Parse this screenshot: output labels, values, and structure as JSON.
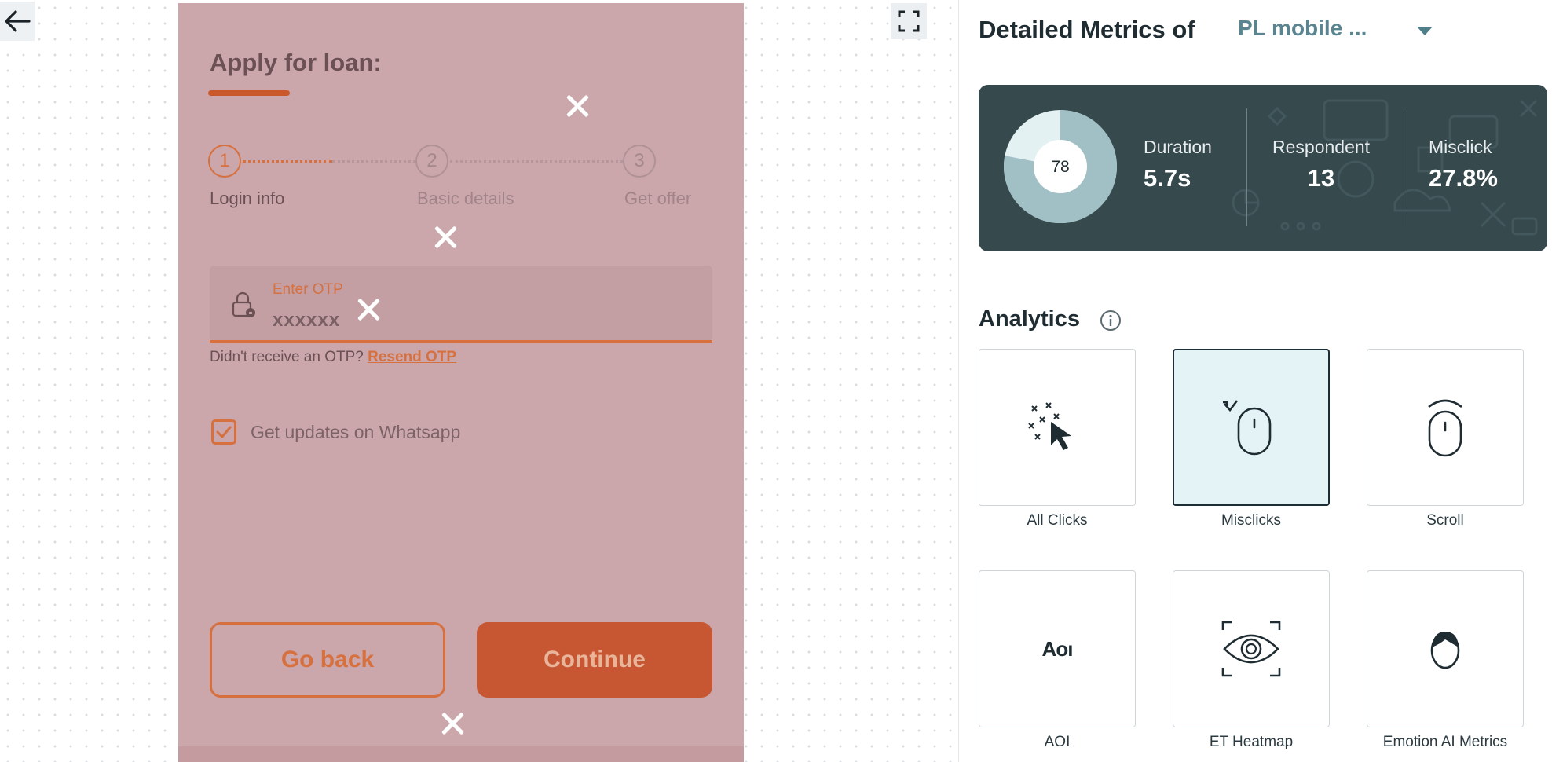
{
  "canvas": {
    "back_icon": "arrow-left-icon",
    "fullscreen_icon": "fullscreen-icon"
  },
  "prototype": {
    "title": "Apply for loan:",
    "steps": [
      {
        "number": "1",
        "label": "Login info",
        "active": true
      },
      {
        "number": "2",
        "label": "Basic details",
        "active": false
      },
      {
        "number": "3",
        "label": "Get offer",
        "active": false
      }
    ],
    "otp_field": {
      "label": "Enter OTP",
      "value": "xxxxxx",
      "icon": "lock-icon"
    },
    "resend_prompt": "Didn't receive an OTP?",
    "resend_link": "Resend OTP",
    "whatsapp_label": "Get updates on Whatsapp",
    "whatsapp_checked": true,
    "go_back_label": "Go back",
    "continue_label": "Continue",
    "colors": {
      "accent": "#d6703f",
      "overlay": "#cba7ab"
    }
  },
  "metrics": {
    "heading": "Detailed Metrics of",
    "selected_task": "PL mobile ...",
    "score": "78",
    "score_fraction": 0.78,
    "duration_label": "Duration",
    "duration_value": "5.7s",
    "respondent_label": "Respondent",
    "respondent_value": "13",
    "misclick_label": "Misclick",
    "misclick_value": "27.8%",
    "card_color": "#36494d"
  },
  "analytics": {
    "heading": "Analytics",
    "info_icon": "info-icon",
    "tiles": [
      {
        "label": "All Clicks",
        "icon": "cursor-clicks-icon",
        "selected": false
      },
      {
        "label": "Misclicks",
        "icon": "mouse-misclick-icon",
        "selected": true
      },
      {
        "label": "Scroll",
        "icon": "mouse-scroll-icon",
        "selected": false
      },
      {
        "label": "AOI",
        "icon_text": "Aoı",
        "selected": false
      },
      {
        "label": "ET Heatmap",
        "icon": "eye-tracking-icon",
        "selected": false
      },
      {
        "label": "Emotion AI Metrics",
        "icon": "face-icon",
        "selected": false
      }
    ]
  }
}
